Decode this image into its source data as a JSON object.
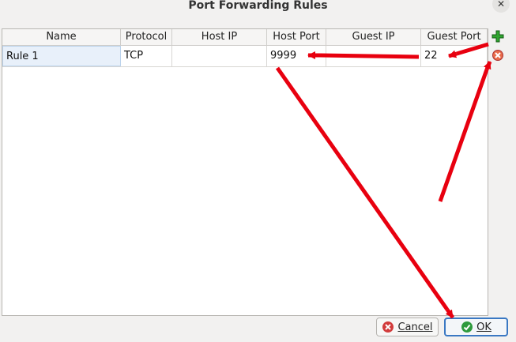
{
  "window": {
    "title": "Port Forwarding Rules"
  },
  "table": {
    "columns": [
      "Name",
      "Protocol",
      "Host IP",
      "Host Port",
      "Guest IP",
      "Guest Port"
    ],
    "rows": [
      {
        "name": "Rule 1",
        "protocol": "TCP",
        "host_ip": "",
        "host_port": "9999",
        "guest_ip": "",
        "guest_port": "22"
      }
    ]
  },
  "buttons": {
    "cancel": {
      "label": "Cancel",
      "icon": "cancel-icon",
      "color": "#d23b3b"
    },
    "ok": {
      "label": "OK",
      "icon": "check-icon",
      "color": "#2e9a3d"
    }
  },
  "side_icons": {
    "add": "add-rule-icon",
    "remove": "remove-rule-icon"
  },
  "annotation_color": "#e8000f"
}
